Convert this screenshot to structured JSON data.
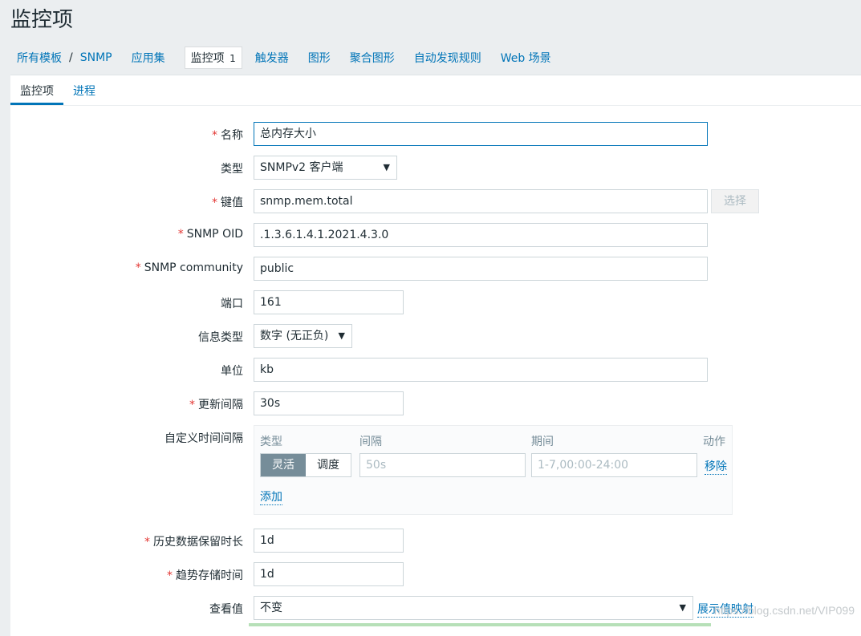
{
  "page": {
    "title": "监控项"
  },
  "breadcrumb": {
    "root": "所有模板",
    "separator": "/",
    "template": "SNMP"
  },
  "nav": {
    "applications": "应用集",
    "items": "监控项",
    "items_count": "1",
    "triggers": "触发器",
    "graphs": "图形",
    "screens": "聚合图形",
    "discovery": "自动发现规则",
    "web": "Web 场景"
  },
  "tabs": {
    "item": "监控项",
    "process": "进程"
  },
  "form": {
    "name": {
      "label": "名称",
      "value": "总内存大小"
    },
    "type": {
      "label": "类型",
      "value": "SNMPv2 客户端"
    },
    "key": {
      "label": "键值",
      "value": "snmp.mem.total",
      "select_button": "选择"
    },
    "snmp_oid": {
      "label": "SNMP OID",
      "value": ".1.3.6.1.4.1.2021.4.3.0"
    },
    "snmp_community": {
      "label": "SNMP community",
      "value": "public"
    },
    "port": {
      "label": "端口",
      "value": "161"
    },
    "info_type": {
      "label": "信息类型",
      "value": "数字 (无正负)"
    },
    "units": {
      "label": "单位",
      "value": "kb"
    },
    "update_interval": {
      "label": "更新间隔",
      "value": "30s"
    },
    "custom_intervals": {
      "label": "自定义时间间隔",
      "col_type": "类型",
      "col_interval": "间隔",
      "col_period": "期间",
      "col_action": "动作",
      "flexible": "灵活",
      "scheduling": "调度",
      "interval_placeholder": "50s",
      "period_placeholder": "1-7,00:00-24:00",
      "remove": "移除",
      "add": "添加"
    },
    "history": {
      "label": "历史数据保留时长",
      "value": "1d"
    },
    "trends": {
      "label": "趋势存储时间",
      "value": "1d"
    },
    "show_value": {
      "label": "查看值",
      "value": "不变",
      "show_mapping": "展示值映射"
    }
  },
  "watermark": "https://blog.csdn.net/VIP099",
  "colors": {
    "accent": "#0275b8",
    "required": "#e33734",
    "toggle_on": "#768d99"
  }
}
